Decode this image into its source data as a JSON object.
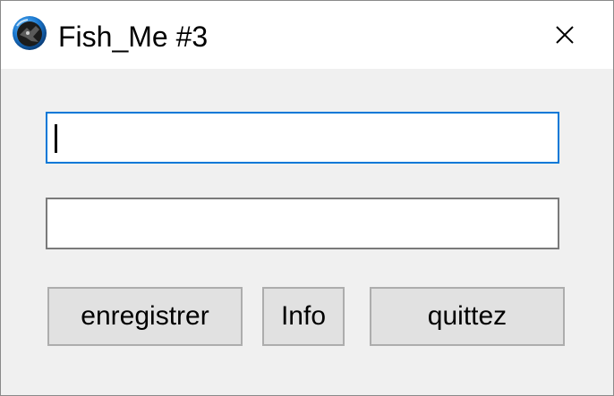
{
  "window": {
    "title": "Fish_Me #3",
    "icon": "fish-disc-app-icon",
    "close_icon": "close-x-icon"
  },
  "fields": [
    {
      "value": "",
      "focused": true
    },
    {
      "value": "",
      "focused": false
    }
  ],
  "buttons": {
    "register_label": "enregistrer",
    "info_label": "Info",
    "quit_label": "quittez"
  },
  "colors": {
    "focus_border": "#0078d7",
    "field_border": "#7a7a7a",
    "button_face": "#e1e1e1",
    "button_border": "#adadad",
    "client_bg": "#f0f0f0"
  }
}
